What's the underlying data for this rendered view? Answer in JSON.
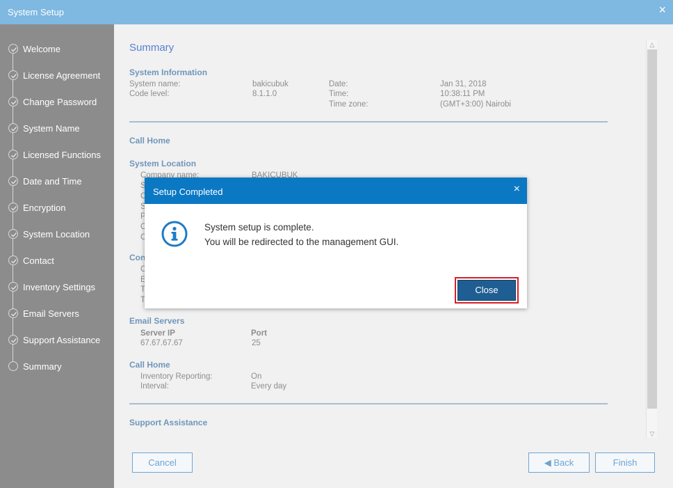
{
  "window": {
    "title": "System Setup"
  },
  "sidebar": {
    "items": [
      {
        "label": "Welcome",
        "state": "done"
      },
      {
        "label": "License Agreement",
        "state": "done"
      },
      {
        "label": "Change Password",
        "state": "done"
      },
      {
        "label": "System Name",
        "state": "done"
      },
      {
        "label": "Licensed Functions",
        "state": "done"
      },
      {
        "label": "Date and Time",
        "state": "done"
      },
      {
        "label": "Encryption",
        "state": "done"
      },
      {
        "label": "System Location",
        "state": "done"
      },
      {
        "label": "Contact",
        "state": "done"
      },
      {
        "label": "Inventory Settings",
        "state": "done"
      },
      {
        "label": "Email Servers",
        "state": "done"
      },
      {
        "label": "Support Assistance",
        "state": "done"
      },
      {
        "label": "Summary",
        "state": "current"
      }
    ]
  },
  "summary": {
    "title": "Summary",
    "system_information": {
      "heading": "System Information",
      "system_name_label": "System name:",
      "system_name_value": "bakicubuk",
      "code_level_label": "Code level:",
      "code_level_value": "8.1.1.0",
      "date_label": "Date:",
      "date_value": "Jan 31, 2018",
      "time_label": "Time:",
      "time_value": "10:38:11 PM",
      "timezone_label": "Time zone:",
      "timezone_value": "(GMT+3:00) Nairobi"
    },
    "call_home_heading": "Call Home",
    "system_location": {
      "heading": "System Location",
      "company_label": "Company name:",
      "company_value": "BAKICUBUK",
      "clipped_initials": [
        "S",
        "C",
        "S",
        "P",
        "C",
        "C"
      ]
    },
    "contact": {
      "heading_clipped": "Con",
      "clipped_initials": [
        "C",
        "E",
        "T",
        "T"
      ]
    },
    "email_servers": {
      "heading": "Email Servers",
      "server_ip_header": "Server IP",
      "port_header": "Port",
      "server_ip": "67.67.67.67",
      "port": "25"
    },
    "call_home_2": {
      "heading": "Call Home",
      "inventory_label": "Inventory Reporting:",
      "inventory_value": "On",
      "interval_label": "Interval:",
      "interval_value": "Every day"
    },
    "support_assistance_heading": "Support Assistance"
  },
  "buttons": {
    "cancel": "Cancel",
    "back": "◀ Back",
    "finish": "Finish"
  },
  "dialog": {
    "title": "Setup Completed",
    "line1": "System setup is complete.",
    "line2": "You will be redirected to the management GUI.",
    "close_button": "Close",
    "close_icon": "×"
  },
  "icons": {
    "window_close": "×",
    "checkmark": "check-icon",
    "info": "info-icon"
  },
  "colors": {
    "titlebar": "#7fb8e0",
    "sidebar": "#8c8c8c",
    "dialog_header": "#0b78c4",
    "primary_button": "#1f5e92",
    "highlight": "#d61f26"
  }
}
